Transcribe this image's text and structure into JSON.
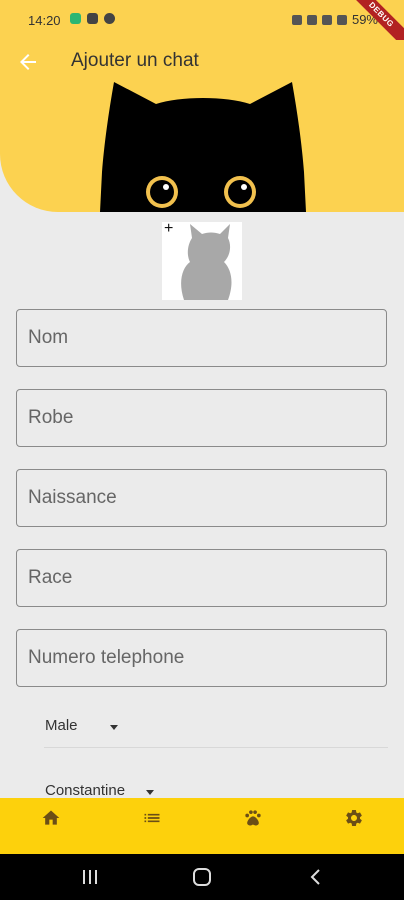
{
  "status_bar": {
    "time": "14:20",
    "battery": "59%",
    "debug_label": "DEBUG"
  },
  "app_bar": {
    "title": "Ajouter un chat",
    "back_icon": "arrow-back-icon"
  },
  "photo_picker": {
    "plus_symbol": "+",
    "icon": "cat-silhouette-icon"
  },
  "form": {
    "nom": {
      "placeholder": "Nom",
      "value": ""
    },
    "robe": {
      "placeholder": "Robe",
      "value": ""
    },
    "naissance": {
      "placeholder": "Naissance",
      "value": ""
    },
    "race": {
      "placeholder": "Race",
      "value": ""
    },
    "telephone": {
      "placeholder": "Numero telephone",
      "value": ""
    }
  },
  "dropdowns": {
    "sexe": {
      "selected": "Male"
    },
    "ville": {
      "selected": "Constantine"
    }
  },
  "bottom_nav": [
    {
      "icon": "home-icon"
    },
    {
      "icon": "list-icon"
    },
    {
      "icon": "paw-icon"
    },
    {
      "icon": "gear-icon"
    }
  ],
  "colors": {
    "accent": "#fcd250",
    "nav": "#fdd10c",
    "background": "#ebebeb"
  }
}
